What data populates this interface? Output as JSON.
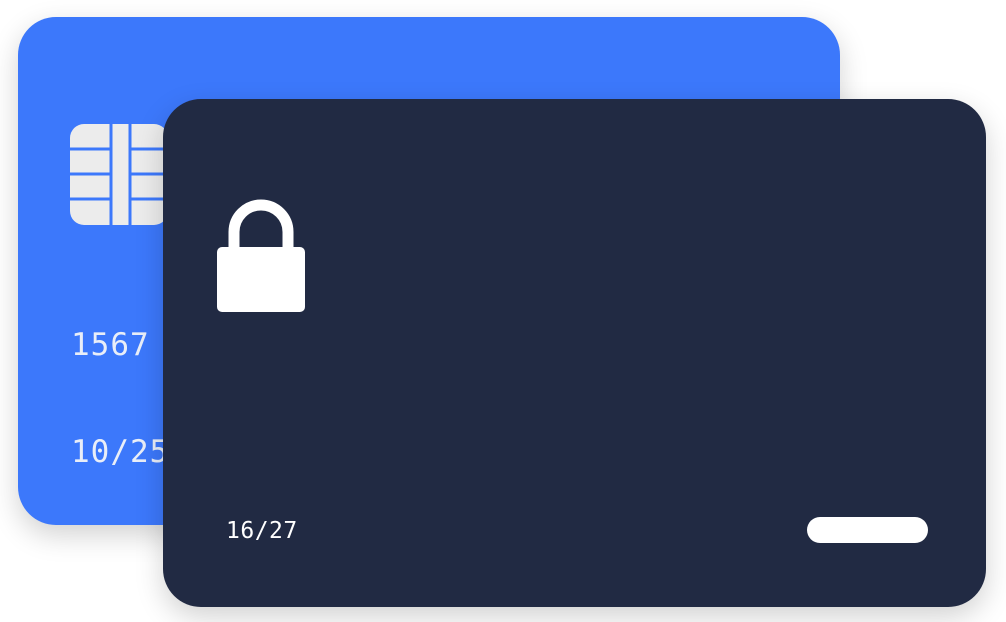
{
  "back_card": {
    "color": "#3c78fb",
    "chip_icon": "chip-icon",
    "number_fragment": "1567",
    "expiry_fragment": "10/25"
  },
  "front_card": {
    "color": "#212a43",
    "lock_icon": "lock-icon",
    "expiry": "16/27",
    "pill_color": "#ffffff"
  }
}
